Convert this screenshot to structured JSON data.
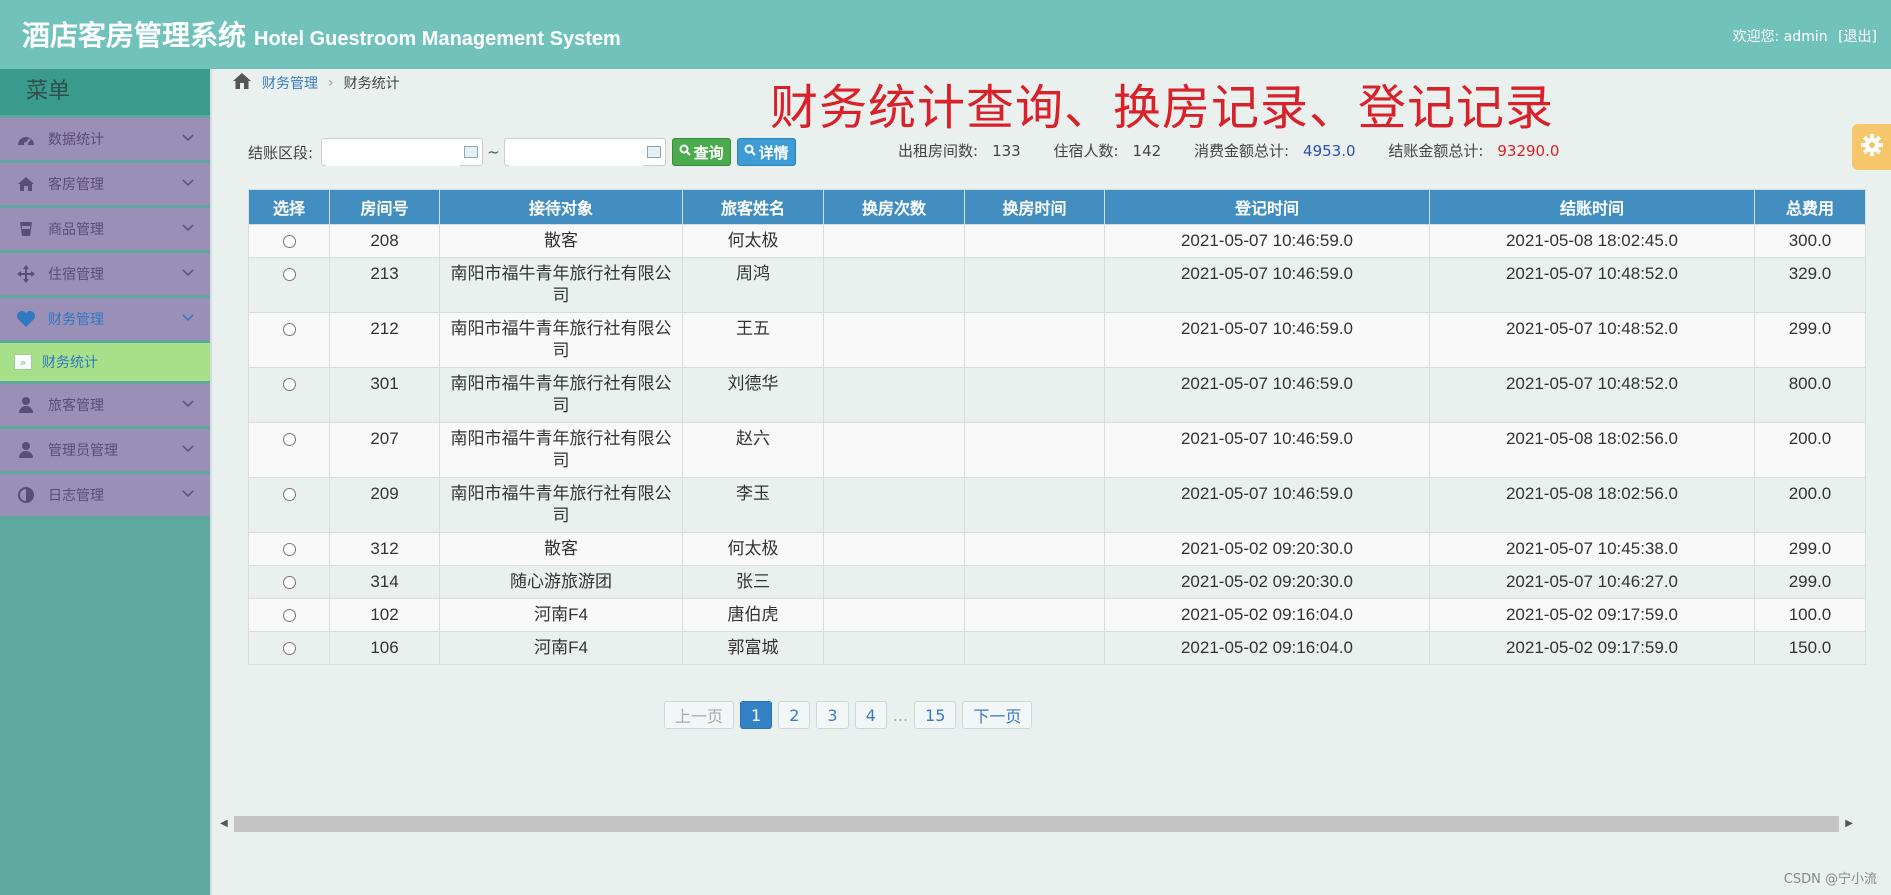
{
  "header": {
    "title_cn": "酒店客房管理系统",
    "title_en": "Hotel Guestroom Management System",
    "welcome": "欢迎您: admin",
    "logout": "[退出]"
  },
  "sidebar": {
    "heading": "菜单",
    "items": [
      {
        "label": "数据统计",
        "icon": "dashboard-icon"
      },
      {
        "label": "客房管理",
        "icon": "home-icon"
      },
      {
        "label": "商品管理",
        "icon": "cup-icon"
      },
      {
        "label": "住宿管理",
        "icon": "move-icon"
      },
      {
        "label": "财务管理",
        "icon": "heart-icon"
      },
      {
        "label": "旅客管理",
        "icon": "user-icon"
      },
      {
        "label": "管理员管理",
        "icon": "user-icon"
      },
      {
        "label": "日志管理",
        "icon": "contrast-icon"
      }
    ],
    "sub_item": "财务统计"
  },
  "breadcrumb": {
    "parent": "财务管理",
    "current": "财务统计"
  },
  "overlay_title": "财务统计查询、换房记录、登记记录",
  "query": {
    "label": "结账区段:",
    "start_value": "",
    "end_value": "",
    "tilde": "~",
    "search_btn": "查询",
    "detail_btn": "详情"
  },
  "stats": {
    "rooms_label": "出租房间数:",
    "rooms": "133",
    "guests_label": "住宿人数:",
    "guests": "142",
    "consume_label": "消费金额总计:",
    "consume": "4953.0",
    "settle_label": "结账金额总计:",
    "settle": "93290.0"
  },
  "table": {
    "headers": [
      "选择",
      "房间号",
      "接待对象",
      "旅客姓名",
      "换房次数",
      "换房时间",
      "登记时间",
      "结账时间",
      "总费用"
    ],
    "rows": [
      {
        "room": "208",
        "target": "散客",
        "name": "何太极",
        "swaps": "",
        "swap_time": "",
        "checkin": "2021-05-07 10:46:59.0",
        "checkout": "2021-05-08 18:02:45.0",
        "total": "300.0"
      },
      {
        "room": "213",
        "target": "南阳市福牛青年旅行社有限公司",
        "name": "周鸿",
        "swaps": "",
        "swap_time": "",
        "checkin": "2021-05-07 10:46:59.0",
        "checkout": "2021-05-07 10:48:52.0",
        "total": "329.0"
      },
      {
        "room": "212",
        "target": "南阳市福牛青年旅行社有限公司",
        "name": "王五",
        "swaps": "",
        "swap_time": "",
        "checkin": "2021-05-07 10:46:59.0",
        "checkout": "2021-05-07 10:48:52.0",
        "total": "299.0"
      },
      {
        "room": "301",
        "target": "南阳市福牛青年旅行社有限公司",
        "name": "刘德华",
        "swaps": "",
        "swap_time": "",
        "checkin": "2021-05-07 10:46:59.0",
        "checkout": "2021-05-07 10:48:52.0",
        "total": "800.0"
      },
      {
        "room": "207",
        "target": "南阳市福牛青年旅行社有限公司",
        "name": "赵六",
        "swaps": "",
        "swap_time": "",
        "checkin": "2021-05-07 10:46:59.0",
        "checkout": "2021-05-08 18:02:56.0",
        "total": "200.0"
      },
      {
        "room": "209",
        "target": "南阳市福牛青年旅行社有限公司",
        "name": "李玉",
        "swaps": "",
        "swap_time": "",
        "checkin": "2021-05-07 10:46:59.0",
        "checkout": "2021-05-08 18:02:56.0",
        "total": "200.0"
      },
      {
        "room": "312",
        "target": "散客",
        "name": "何太极",
        "swaps": "",
        "swap_time": "",
        "checkin": "2021-05-02 09:20:30.0",
        "checkout": "2021-05-07 10:45:38.0",
        "total": "299.0"
      },
      {
        "room": "314",
        "target": "随心游旅游团",
        "name": "张三",
        "swaps": "",
        "swap_time": "",
        "checkin": "2021-05-02 09:20:30.0",
        "checkout": "2021-05-07 10:46:27.0",
        "total": "299.0"
      },
      {
        "room": "102",
        "target": "河南F4",
        "name": "唐伯虎",
        "swaps": "",
        "swap_time": "",
        "checkin": "2021-05-02 09:16:04.0",
        "checkout": "2021-05-02 09:17:59.0",
        "total": "100.0"
      },
      {
        "room": "106",
        "target": "河南F4",
        "name": "郭富城",
        "swaps": "",
        "swap_time": "",
        "checkin": "2021-05-02 09:16:04.0",
        "checkout": "2021-05-02 09:17:59.0",
        "total": "150.0"
      }
    ]
  },
  "pagination": {
    "prev": "上一页",
    "pages": [
      "1",
      "2",
      "3",
      "4"
    ],
    "ellipsis": "...",
    "last": "15",
    "next": "下一页",
    "current": "1"
  },
  "watermark": "CSDN @宁小流",
  "colors": {
    "header_bg": "#70c2bb",
    "sidebar_item": "#9a8fb7",
    "sidebar_active_sub": "#a8e08a",
    "table_header": "#438ec1",
    "accent_red": "#d9212a"
  }
}
